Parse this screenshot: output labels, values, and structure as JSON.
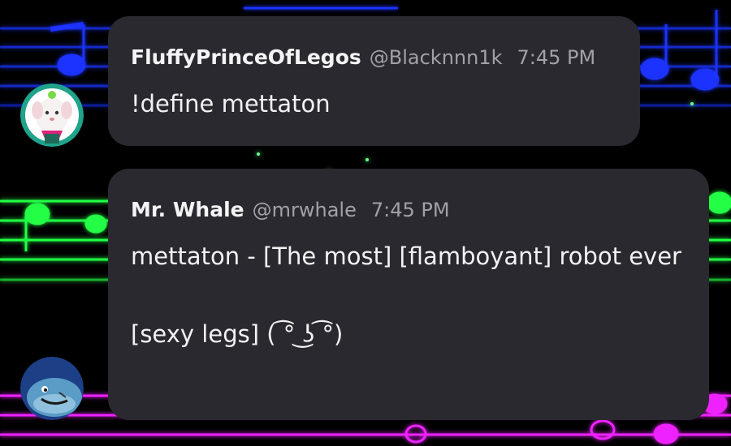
{
  "colors": {
    "background": "#000000",
    "bubble": "#2a292f",
    "name_text": "#f4f4f6",
    "meta_text": "#a2a1a9",
    "music_blue": "#1a33ff",
    "music_green": "#22ff44",
    "music_magenta": "#ee22ff"
  },
  "background": {
    "decoration": "neon music staff lines and notes"
  },
  "messages": [
    {
      "avatar": "fluffy-white-goat-avatar",
      "author": "FluffyPrinceOfLegos",
      "handle": "@Blacknnn1k",
      "time": "7:45 PM",
      "text": "!define mettaton"
    },
    {
      "avatar": "blue-whale-avatar",
      "author": "Mr. Whale",
      "handle": "@mrwhale",
      "time": "7:45 PM",
      "text": "mettaton - [The most] [flamboyant] robot ever\n\n[sexy legs] ( ͡° ͜ʖ ͡°)"
    }
  ]
}
